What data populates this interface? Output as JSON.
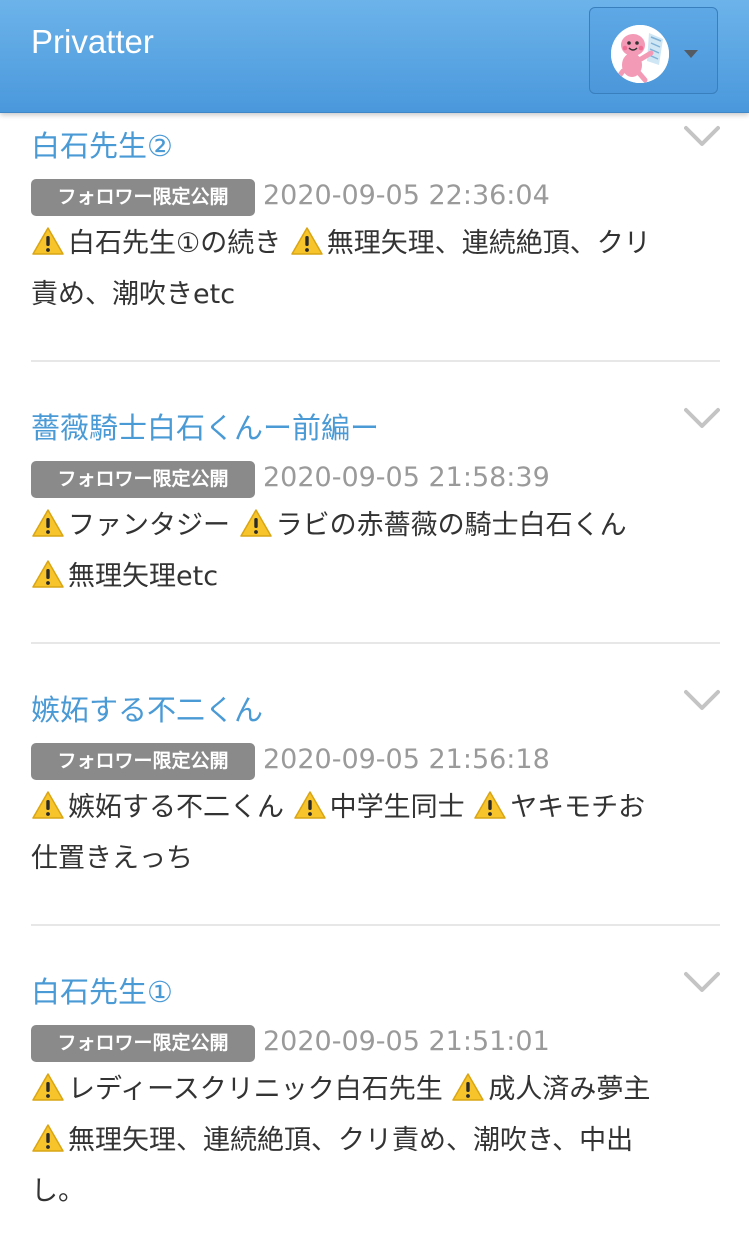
{
  "navbar": {
    "brand": "Privatter",
    "user_menu": {
      "avatar_icon": "pink-character-avatar-icon",
      "caret_icon": "caret-down-icon"
    }
  },
  "colors": {
    "navbar_top": "#6cb3ea",
    "navbar_bottom": "#4a98dc",
    "title_link": "#4a9ad6",
    "badge_bg": "#8a8a8a",
    "datetime": "#9a9a9a",
    "warning_yellow": "#f7c52b"
  },
  "posts": [
    {
      "title": "白石先生②",
      "badge": "フォロワー限定公開",
      "datetime": "2020-09-05 22:36:04",
      "lines": [
        [
          {
            "warn": true,
            "text": "白石先生①の続き "
          },
          {
            "warn": true,
            "text": "無理矢理、連続絶頂、クリ"
          }
        ],
        [
          {
            "warn": false,
            "text": "責め、潮吹きetc"
          }
        ]
      ]
    },
    {
      "title": "薔薇騎士白石くんー前編ー",
      "badge": "フォロワー限定公開",
      "datetime": "2020-09-05 21:58:39",
      "lines": [
        [
          {
            "warn": true,
            "text": "ファンタジー "
          },
          {
            "warn": true,
            "text": "ラビの赤薔薇の騎士白石くん"
          }
        ],
        [
          {
            "warn": true,
            "text": "無理矢理etc"
          }
        ]
      ]
    },
    {
      "title": "嫉妬する不二くん",
      "badge": "フォロワー限定公開",
      "datetime": "2020-09-05 21:56:18",
      "lines": [
        [
          {
            "warn": true,
            "text": "嫉妬する不二くん "
          },
          {
            "warn": true,
            "text": "中学生同士 "
          },
          {
            "warn": true,
            "text": "ヤキモチお"
          }
        ],
        [
          {
            "warn": false,
            "text": "仕置きえっち"
          }
        ]
      ]
    },
    {
      "title": "白石先生①",
      "badge": "フォロワー限定公開",
      "datetime": "2020-09-05 21:51:01",
      "lines": [
        [
          {
            "warn": true,
            "text": "レディースクリニック白石先生 "
          },
          {
            "warn": true,
            "text": "成人済み夢主"
          }
        ],
        [
          {
            "warn": true,
            "text": "無理矢理、連続絶頂、クリ責め、潮吹き、中出"
          }
        ],
        [
          {
            "warn": false,
            "text": "し。"
          }
        ]
      ]
    }
  ]
}
